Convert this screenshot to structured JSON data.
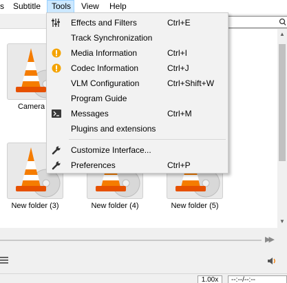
{
  "menubar": {
    "items": [
      "s",
      "Subtitle",
      "Tools",
      "View",
      "Help"
    ],
    "active": "Tools"
  },
  "library": {
    "tiles": [
      {
        "label": "Camera R"
      },
      {
        "label": ""
      },
      {
        "label": ""
      },
      {
        "label": "New folder (3)"
      },
      {
        "label": "New folder (4)"
      },
      {
        "label": "New folder (5)"
      }
    ]
  },
  "tools_menu": {
    "items": [
      {
        "label": "Effects and Filters",
        "shortcut": "Ctrl+E",
        "icon": "equalizer-icon"
      },
      {
        "label": "Track Synchronization",
        "shortcut": "",
        "icon": ""
      },
      {
        "label": "Media Information",
        "shortcut": "Ctrl+I",
        "icon": "info-warning-icon"
      },
      {
        "label": "Codec Information",
        "shortcut": "Ctrl+J",
        "icon": "info-warning-icon"
      },
      {
        "label": "VLM Configuration",
        "shortcut": "Ctrl+Shift+W",
        "icon": ""
      },
      {
        "label": "Program Guide",
        "shortcut": "",
        "icon": ""
      },
      {
        "label": "Messages",
        "shortcut": "Ctrl+M",
        "icon": "terminal-icon"
      },
      {
        "label": "Plugins and extensions",
        "shortcut": "",
        "icon": ""
      },
      {
        "label": "Customize Interface...",
        "shortcut": "",
        "icon": "wrench-icon"
      },
      {
        "label": "Preferences",
        "shortcut": "Ctrl+P",
        "icon": "wrench-icon"
      }
    ]
  },
  "status": {
    "speed": "1.00x",
    "time": "--:--/--:--"
  },
  "colors": {
    "accent_hover": "#cce8ff",
    "cone_orange": "#f57c00",
    "warning_orange": "#f4a300"
  }
}
